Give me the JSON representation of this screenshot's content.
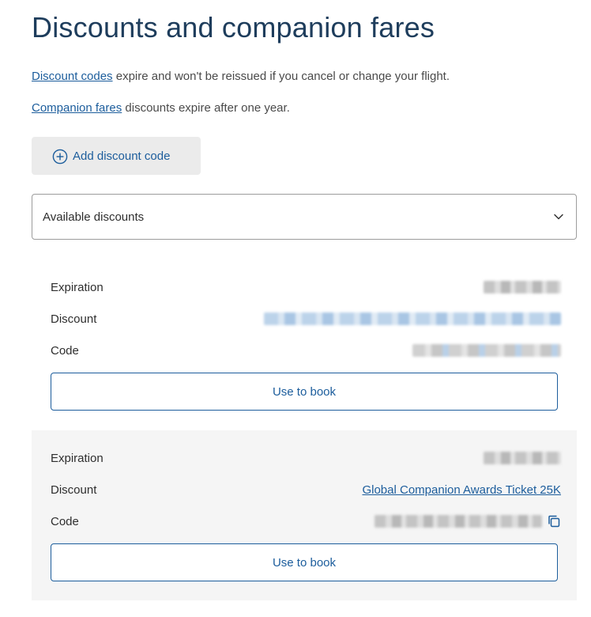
{
  "page": {
    "title": "Discounts and companion fares"
  },
  "info": {
    "discount_codes_link": "Discount codes",
    "discount_codes_text": " expire and won't be reissued if you cancel or change your flight.",
    "companion_fares_link": "Companion fares",
    "companion_fares_text": " discounts expire after one year."
  },
  "add_button": {
    "label": "Add discount code",
    "icon": "plus-circle-icon"
  },
  "dropdown": {
    "label": "Available discounts",
    "icon": "chevron-down-icon"
  },
  "discounts": [
    {
      "expiration_label": "Expiration",
      "discount_label": "Discount",
      "code_label": "Code",
      "discount_value": "",
      "book_label": "Use to book"
    },
    {
      "expiration_label": "Expiration",
      "discount_label": "Discount",
      "code_label": "Code",
      "discount_value": "Global Companion Awards Ticket 25K",
      "book_label": "Use to book",
      "copy_icon": "copy-icon"
    }
  ],
  "colors": {
    "title": "#1e3d5c",
    "link": "#1c5d9c",
    "button_bg": "#ebebeb",
    "card_alt_bg": "#f5f5f5"
  }
}
